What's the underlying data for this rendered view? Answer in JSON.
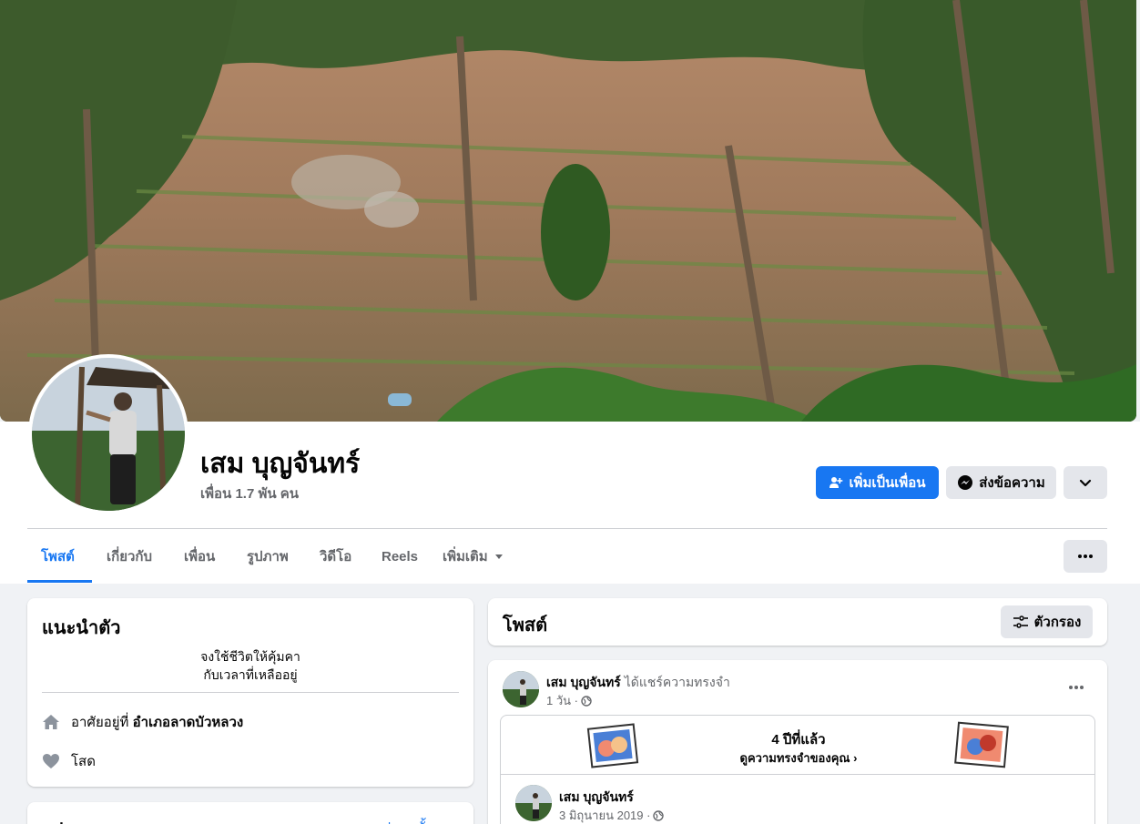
{
  "profile": {
    "name": "เสม บุญจันทร์",
    "friends": "เพื่อน 1.7 พัน คน"
  },
  "actions": {
    "add_friend": "เพิ่มเป็นเพื่อน",
    "message": "ส่งข้อความ"
  },
  "tabs": [
    {
      "label": "โพสต์"
    },
    {
      "label": "เกี่ยวกับ"
    },
    {
      "label": "เพื่อน"
    },
    {
      "label": "รูปภาพ"
    },
    {
      "label": "วิดีโอ"
    },
    {
      "label": "Reels"
    },
    {
      "label": "เพิ่มเติม"
    }
  ],
  "intro": {
    "title": "แนะนำตัว",
    "bio_line1": "จงใช้ชีวิตให้คุ้มคา",
    "bio_line2": "กับเวลาที่เหลืออยู่",
    "lives_prefix": "อาศัยอยู่ที่",
    "lives_place": "อำเภอลาดบัวหลวง",
    "relationship": "โสด"
  },
  "photos_card": {
    "title": "รูปภาพ",
    "see_all": "ดูรูปภาพทั้งหมด"
  },
  "posts": {
    "title": "โพสต์",
    "filter": "ตัวกรอง"
  },
  "post": {
    "author": "เสม บุญจันทร์",
    "action": "ได้แชร์ความทรงจำ",
    "time": "1 วัน ·",
    "memory_title": "4 ปีที่แล้ว",
    "memory_link": "ดูความทรงจำของคุณ",
    "inner_author": "เสม บุญจันทร์",
    "inner_time": "3 มิถุนายน 2019 ·"
  },
  "colors": {
    "accent": "#1877f2",
    "background": "#f0f2f5"
  }
}
